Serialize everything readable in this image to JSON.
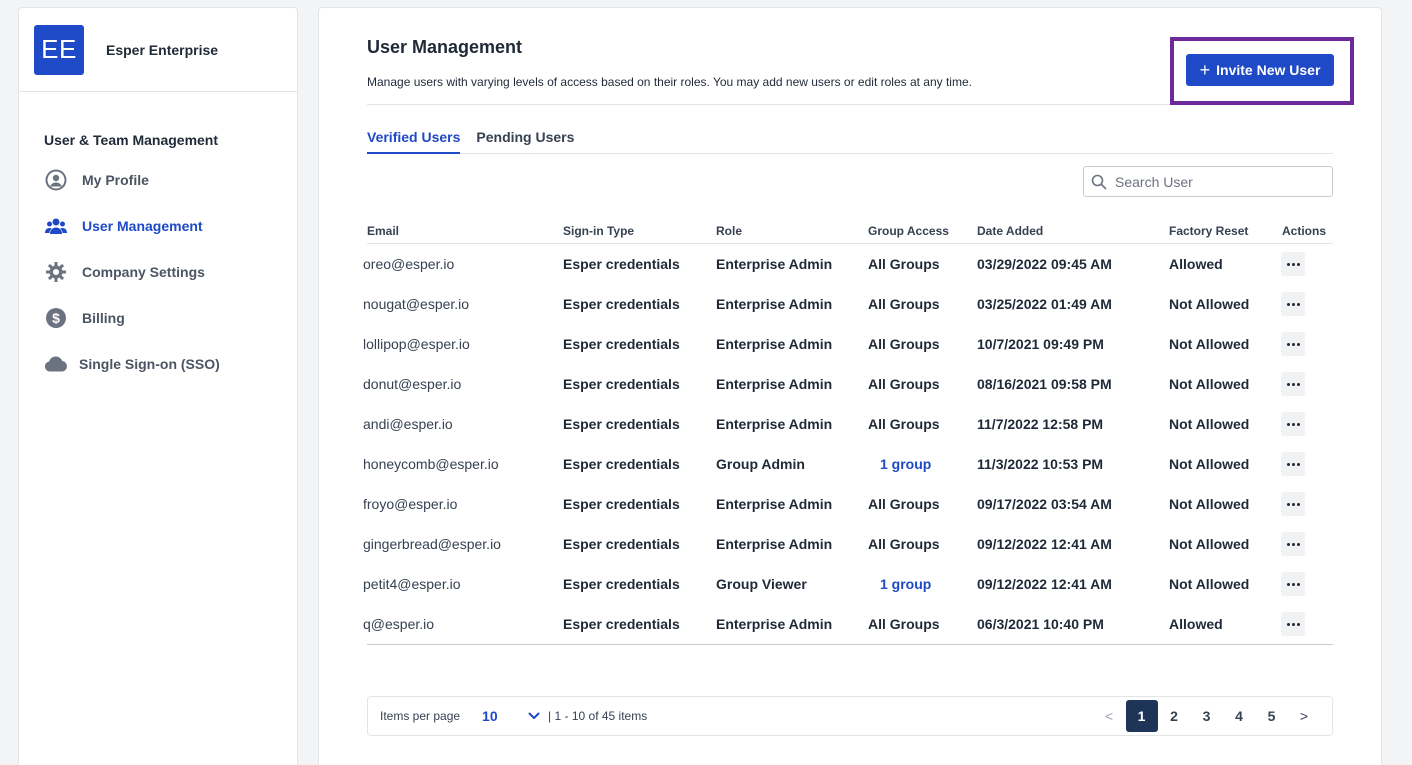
{
  "brand": {
    "logo_text": "EE",
    "name": "Esper Enterprise"
  },
  "sidebar": {
    "heading": "User & Team Management",
    "items": [
      {
        "label": "My Profile",
        "icon": "user-circle-icon",
        "active": false
      },
      {
        "label": "User Management",
        "icon": "users-icon",
        "active": true
      },
      {
        "label": "Company Settings",
        "icon": "gear-icon",
        "active": false
      },
      {
        "label": "Billing",
        "icon": "dollar-circle-icon",
        "active": false
      },
      {
        "label": "Single Sign-on (SSO)",
        "icon": "cloud-icon",
        "active": false
      }
    ]
  },
  "header": {
    "title": "User Management",
    "description": "Manage users with varying levels of access based on their roles. You may add new users or edit roles at any time.",
    "invite_label": "Invite New User",
    "highlight_color": "#6c2a9c"
  },
  "tabs": [
    {
      "label": "Verified Users",
      "active": true
    },
    {
      "label": "Pending Users",
      "active": false
    }
  ],
  "search": {
    "placeholder": "Search User",
    "value": ""
  },
  "table": {
    "columns": [
      "Email",
      "Sign-in Type",
      "Role",
      "Group Access",
      "Date Added",
      "Factory Reset",
      "Actions"
    ],
    "rows": [
      {
        "email": "oreo@esper.io",
        "signin": "Esper credentials",
        "role": "Enterprise Admin",
        "group": "All Groups",
        "date": "03/29/2022 09:45 AM",
        "reset": "Allowed"
      },
      {
        "email": "nougat@esper.io",
        "signin": "Esper credentials",
        "role": "Enterprise Admin",
        "group": "All Groups",
        "date": "03/25/2022 01:49 AM",
        "reset": "Not Allowed"
      },
      {
        "email": "lollipop@esper.io",
        "signin": "Esper credentials",
        "role": "Enterprise Admin",
        "group": "All Groups",
        "date": "10/7/2021 09:49 PM",
        "reset": "Not Allowed"
      },
      {
        "email": "donut@esper.io",
        "signin": "Esper credentials",
        "role": "Enterprise Admin",
        "group": "All Groups",
        "date": "08/16/2021 09:58 PM",
        "reset": "Not Allowed"
      },
      {
        "email": "andi@esper.io",
        "signin": "Esper credentials",
        "role": "Enterprise Admin",
        "group": "All Groups",
        "date": "11/7/2022 12:58 PM",
        "reset": "Not Allowed"
      },
      {
        "email": "honeycomb@esper.io",
        "signin": "Esper credentials",
        "role": "Group Admin",
        "group": "1 group",
        "date": "11/3/2022 10:53 PM",
        "reset": "Not Allowed"
      },
      {
        "email": "froyo@esper.io",
        "signin": "Esper credentials",
        "role": "Enterprise Admin",
        "group": "All Groups",
        "date": "09/17/2022 03:54 AM",
        "reset": "Not Allowed"
      },
      {
        "email": "gingerbread@esper.io",
        "signin": "Esper credentials",
        "role": "Enterprise Admin",
        "group": "All Groups",
        "date": "09/12/2022 12:41 AM",
        "reset": "Not Allowed"
      },
      {
        "email": "petit4@esper.io",
        "signin": "Esper credentials",
        "role": "Group Viewer",
        "group": "1 group",
        "date": "09/12/2022 12:41 AM",
        "reset": "Not Allowed"
      },
      {
        "email": "q@esper.io",
        "signin": "Esper credentials",
        "role": "Enterprise Admin",
        "group": "All Groups",
        "date": "06/3/2021 10:40 PM",
        "reset": "Allowed"
      }
    ]
  },
  "pagination": {
    "items_per_page_label": "Items per page",
    "items_per_page": "10",
    "range_text": "| 1 - 10 of 45 items",
    "prev": "<",
    "next": ">",
    "pages": [
      "1",
      "2",
      "3",
      "4",
      "5"
    ],
    "current": "1"
  },
  "colors": {
    "accent": "#1e49c7",
    "active_page": "#1f3558"
  }
}
